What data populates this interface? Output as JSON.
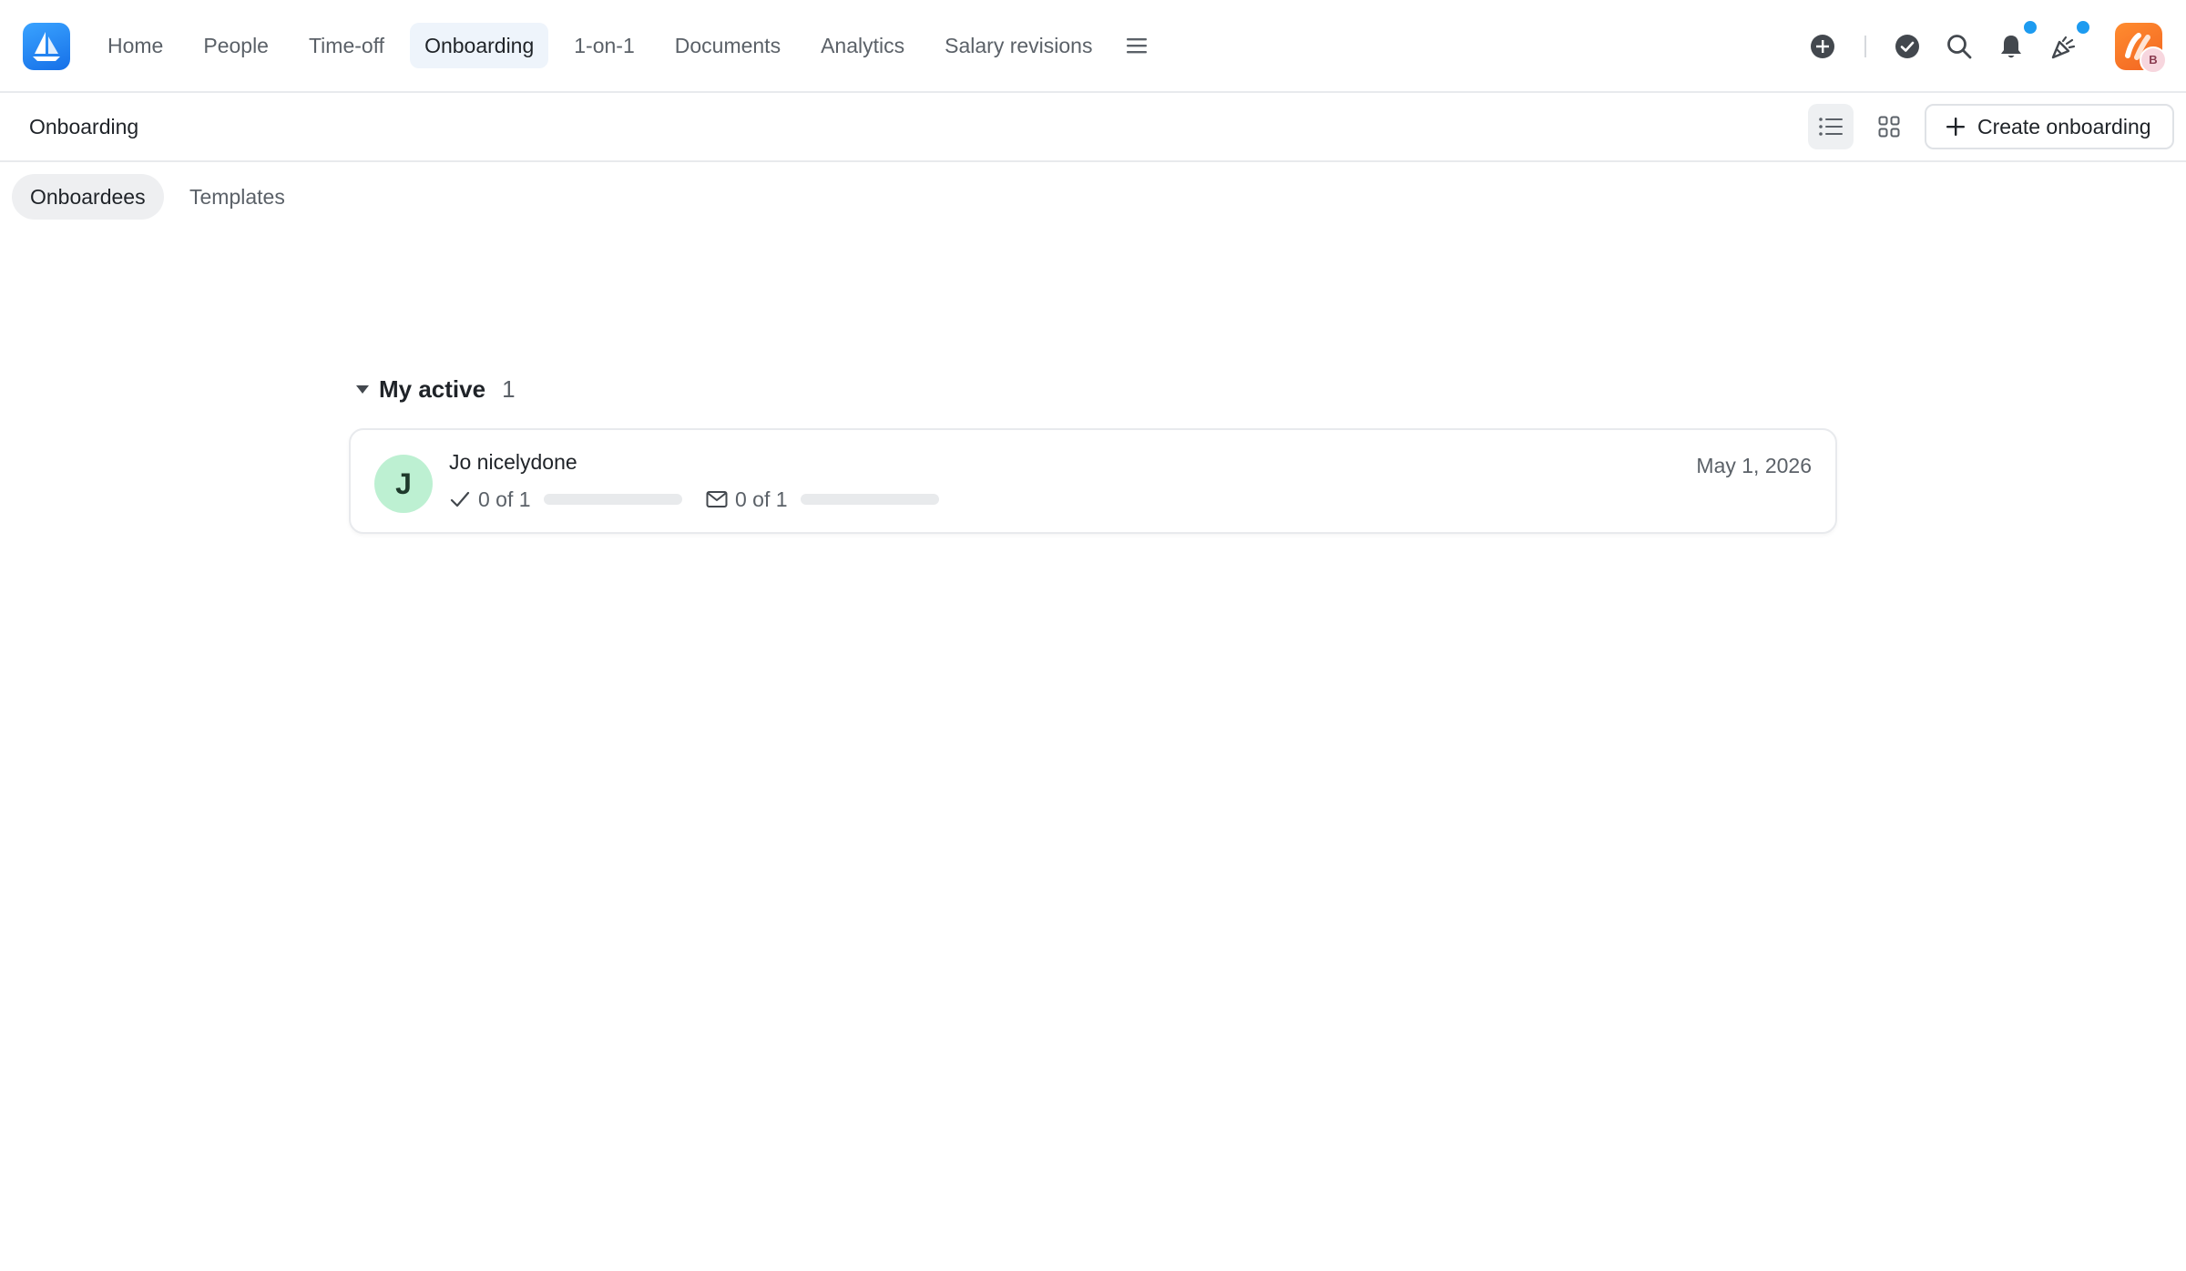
{
  "nav": {
    "items": [
      {
        "label": "Home",
        "active": false
      },
      {
        "label": "People",
        "active": false
      },
      {
        "label": "Time-off",
        "active": false
      },
      {
        "label": "Onboarding",
        "active": true
      },
      {
        "label": "1-on-1",
        "active": false
      },
      {
        "label": "Documents",
        "active": false
      },
      {
        "label": "Analytics",
        "active": false
      },
      {
        "label": "Salary revisions",
        "active": false
      }
    ],
    "more_icon": "hamburger-menu-icon",
    "actions": [
      "add-circle-icon",
      "check-circle-icon",
      "search-icon",
      "bell-icon",
      "celebration-icon"
    ],
    "user_initial": "B",
    "accent_color": "#1d9bf0"
  },
  "subheader": {
    "title": "Onboarding",
    "create_label": "Create onboarding",
    "view_list_icon": "list-view-icon",
    "view_grid_icon": "grid-view-icon"
  },
  "tabs": [
    {
      "label": "Onboardees",
      "active": true
    },
    {
      "label": "Templates",
      "active": false
    }
  ],
  "section": {
    "title": "My active",
    "count": "1",
    "expanded": true
  },
  "onboardees": [
    {
      "initial": "J",
      "name": "Jo nicelydone",
      "tasks_text": "0 of 1",
      "tasks_progress": 0,
      "emails_text": "0 of 1",
      "emails_progress": 0,
      "date": "May 1, 2026"
    }
  ]
}
